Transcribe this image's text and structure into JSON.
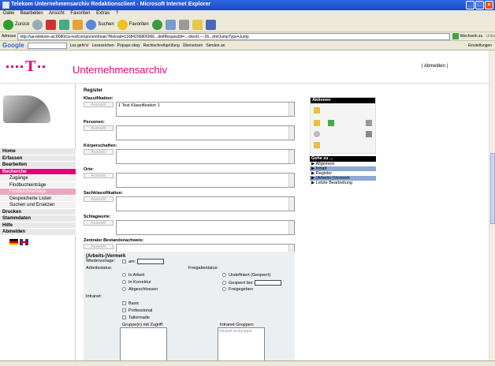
{
  "window": {
    "title": "Telekom Unternehmensarchiv Redaktionsclient - Microsoft Internet Explorer"
  },
  "menubar": [
    "Datei",
    "Bearbeiten",
    "Ansicht",
    "Favoriten",
    "Extras",
    "?"
  ],
  "toolbar": {
    "back": "Zurück",
    "search": "Suchen",
    "favorites": "Favoriten"
  },
  "addressbar": {
    "label": "Adresse",
    "url": "http://ua-telekom-as:8080/ca-red/component/main?Reload=11684296806566...dmfRequestId=...client1----26...dmfJumpType=Jump",
    "go": "Wechseln zu",
    "links": "Links"
  },
  "googlebar": {
    "logo": "Google",
    "go": "Los geht's!",
    "bookmarks": "Lesezeichen",
    "popups": "Popups okay",
    "spell": "Rechtschreibprüfung",
    "translate": "Übersetzen",
    "send": "Senden an",
    "settings": "Einstellungen"
  },
  "app": {
    "title": "Unternehmensarchiv",
    "logout": "| Abmelden |"
  },
  "nav": [
    {
      "label": "Home",
      "level": 0,
      "active": false
    },
    {
      "label": "Erfassen",
      "level": 0,
      "active": false
    },
    {
      "label": "Bearbeiten",
      "level": 0,
      "active": false
    },
    {
      "label": "Recherche",
      "level": 0,
      "active": true
    },
    {
      "label": "Zugänge",
      "level": 1,
      "active": false
    },
    {
      "label": "Findbucheinträge",
      "level": 1,
      "active": false
    },
    {
      "label": "Findbuchverträge",
      "level": 1,
      "active": true
    },
    {
      "label": "Gespeicherte Listen",
      "level": 1,
      "active": false
    },
    {
      "label": "Suchen und Ersetzen",
      "level": 1,
      "active": false
    },
    {
      "label": "Drucken",
      "level": 0,
      "active": false
    },
    {
      "label": "Stammdaten",
      "level": 0,
      "active": false
    },
    {
      "label": "Hilfe",
      "level": 0,
      "active": false
    },
    {
      "label": "Abmelden",
      "level": 0,
      "active": false
    }
  ],
  "register": {
    "title": "Register",
    "fields": [
      {
        "label": "Klassifikation:",
        "button": "Auswahl",
        "value": "1 Test Klassifikation 1"
      },
      {
        "label": "Personen:",
        "button": "Auswahl",
        "value": ""
      },
      {
        "label": "Körperschaften:",
        "button": "Auswahl",
        "value": ""
      },
      {
        "label": "Orte:",
        "button": "Auswahl",
        "value": ""
      },
      {
        "label": "Sachklassifikation:",
        "button": "Auswahl",
        "value": ""
      },
      {
        "label": "Schlagworte:",
        "button": "Auswahl",
        "value": ""
      },
      {
        "label": "Zentraler Bestandsnachweis:",
        "button": "Auswahl",
        "value": ""
      }
    ]
  },
  "vermerk": {
    "title": "(Arbeits-)Vermerk",
    "wiedervorlage": "Wiedervorlage:",
    "am": "am:",
    "arbeitsstatus": "Arbeitsstatus:",
    "status_options": [
      "In Arbeit",
      "In Korrektur",
      "Abgeschlossen"
    ],
    "freigabestatus": "Freigabestatus:",
    "freigabe_options": [
      "Undefiniert (Gesperrt)",
      "Gesperrt bis:",
      "Freigegeben"
    ],
    "intranet": "Intranet:",
    "intranet_options": [
      "Basic",
      "Professional",
      "Tailormade"
    ],
    "gruppen": "Gruppe(n) mit Zugriff:",
    "intranet_gruppen": "Intranet-Gruppen:",
    "intranet_gruppen_item": "intranet testgruppe"
  },
  "aktionen": {
    "title": "Aktionen"
  },
  "gehezu": {
    "title": "Gehe zu ...",
    "items": [
      {
        "label": "▶ Allgemein",
        "hl": false
      },
      {
        "label": "▶ Inhalt",
        "hl": true
      },
      {
        "label": "▶ Register",
        "hl": false
      },
      {
        "label": "▶ (Arbeits-)Vermerk",
        "hl": true
      },
      {
        "label": "▶ Letzte Bearbeitung",
        "hl": false
      }
    ]
  },
  "colors": {
    "magenta": "#e20074",
    "xp_blue": "#2f66e0"
  }
}
